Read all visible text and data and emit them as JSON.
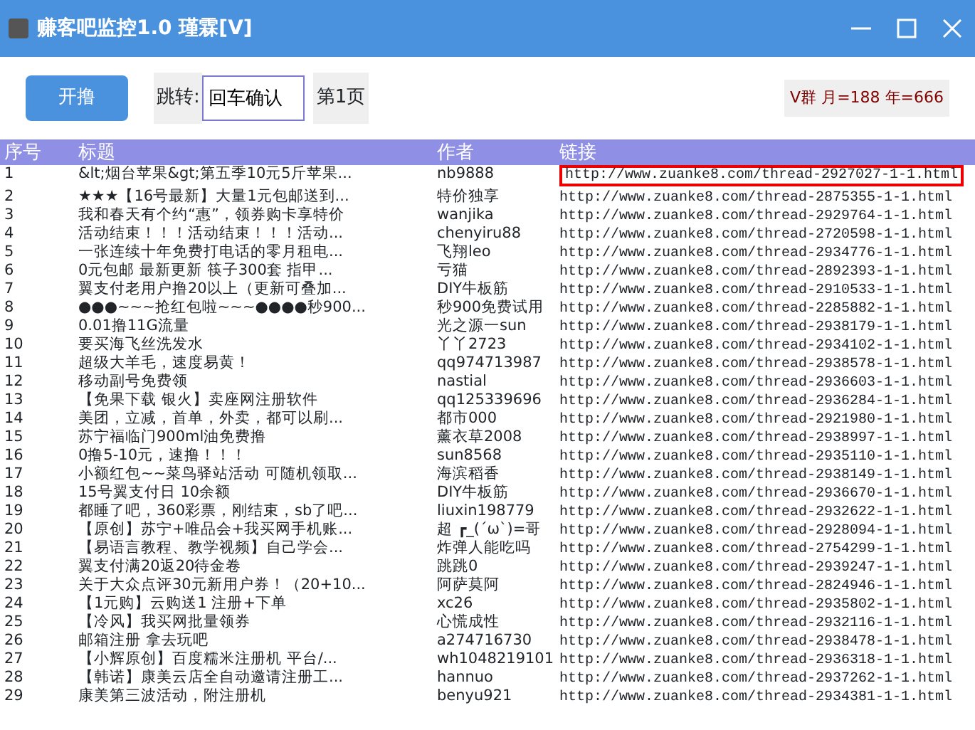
{
  "window": {
    "title": "赚客吧监控1.0 瑾霖[V]"
  },
  "toolbar": {
    "start_button": "开撸",
    "jump_label": "跳转:",
    "jump_field": {
      "value": "回车确认"
    },
    "page_label": "第1页",
    "notice": "V群 月=188 年=666"
  },
  "table": {
    "columns": [
      "序号",
      "标题",
      "作者",
      "链接"
    ],
    "rows": [
      {
        "cells": [
          "1",
          "&lt;烟台苹果&gt;第五季10元5斤苹果...",
          "nb9888",
          "http://www.zuanke8.com/thread-2927027-1-1.html"
        ],
        "highlighted": true
      },
      {
        "cells": [
          "2",
          "★★★【16号最新】大量1元包邮送到...",
          "特价独享",
          "http://www.zuanke8.com/thread-2875355-1-1.html"
        ],
        "highlighted": false
      },
      {
        "cells": [
          "3",
          "我和春天有个约“惠”，领券购卡享特价",
          "wanjika",
          "http://www.zuanke8.com/thread-2929764-1-1.html"
        ],
        "highlighted": false
      },
      {
        "cells": [
          "4",
          "活动结束！！！活动结束！！！活动...",
          "chenyiru88",
          "http://www.zuanke8.com/thread-2720598-1-1.html"
        ],
        "highlighted": false
      },
      {
        "cells": [
          "5",
          "一张连续十年免费打电话的零月租电...",
          "飞翔leo",
          "http://www.zuanke8.com/thread-2934776-1-1.html"
        ],
        "highlighted": false
      },
      {
        "cells": [
          "6",
          "0元包邮  最新更新 筷子300套 指甲...",
          "亏猫",
          "http://www.zuanke8.com/thread-2892393-1-1.html"
        ],
        "highlighted": false
      },
      {
        "cells": [
          "7",
          "翼支付老用户撸20以上（更新可叠加...",
          "DIY牛板筋",
          "http://www.zuanke8.com/thread-2910533-1-1.html"
        ],
        "highlighted": false
      },
      {
        "cells": [
          "8",
          "●●●~~~抢红包啦~~~●●●●秒900...",
          "秒900免费试用",
          "http://www.zuanke8.com/thread-2285882-1-1.html"
        ],
        "highlighted": false
      },
      {
        "cells": [
          "9",
          "0.01撸11G流量",
          "光之源一sun",
          "http://www.zuanke8.com/thread-2938179-1-1.html"
        ],
        "highlighted": false
      },
      {
        "cells": [
          "10",
          "要买海飞丝洗发水",
          "丫丫2723",
          "http://www.zuanke8.com/thread-2934102-1-1.html"
        ],
        "highlighted": false
      },
      {
        "cells": [
          "11",
          "超级大羊毛，速度易黄！",
          "qq974713987",
          "http://www.zuanke8.com/thread-2938578-1-1.html"
        ],
        "highlighted": false
      },
      {
        "cells": [
          "12",
          "移动副号免费领",
          "nastial",
          "http://www.zuanke8.com/thread-2936603-1-1.html"
        ],
        "highlighted": false
      },
      {
        "cells": [
          "13",
          "【免果下载 银火】卖座网注册软件",
          "qq125339696",
          "http://www.zuanke8.com/thread-2936284-1-1.html"
        ],
        "highlighted": false
      },
      {
        "cells": [
          "14",
          "美团，立减，首单，外卖，都可以刷...",
          "都市000",
          "http://www.zuanke8.com/thread-2921980-1-1.html"
        ],
        "highlighted": false
      },
      {
        "cells": [
          "15",
          "苏宁福临门900ml油免费撸",
          "薰衣草2008",
          "http://www.zuanke8.com/thread-2938997-1-1.html"
        ],
        "highlighted": false
      },
      {
        "cells": [
          "16",
          "0撸5-10元，速撸！！！",
          "sun8568",
          "http://www.zuanke8.com/thread-2935110-1-1.html"
        ],
        "highlighted": false
      },
      {
        "cells": [
          "17",
          "小额红包~~菜鸟驿站活动 可随机领取...",
          "海滨稻香",
          "http://www.zuanke8.com/thread-2938149-1-1.html"
        ],
        "highlighted": false
      },
      {
        "cells": [
          "18",
          "15号翼支付日 10余额",
          "DIY牛板筋",
          "http://www.zuanke8.com/thread-2936670-1-1.html"
        ],
        "highlighted": false
      },
      {
        "cells": [
          "19",
          "都睡了吧，360彩票，刚结束，sb了吧...",
          "liuxin198779",
          "http://www.zuanke8.com/thread-2932622-1-1.html"
        ],
        "highlighted": false
      },
      {
        "cells": [
          "20",
          "【原创】苏宁+唯品会+我买网手机账...",
          "超 ┏_(ˊωˋ)=哥",
          "http://www.zuanke8.com/thread-2928094-1-1.html"
        ],
        "highlighted": false
      },
      {
        "cells": [
          "21",
          "【易语言教程、教学视频】自己学会...",
          "炸弹人能吃吗",
          "http://www.zuanke8.com/thread-2754299-1-1.html"
        ],
        "highlighted": false
      },
      {
        "cells": [
          "22",
          "翼支付满20返20待金卷",
          "跳跳0",
          "http://www.zuanke8.com/thread-2939247-1-1.html"
        ],
        "highlighted": false
      },
      {
        "cells": [
          "23",
          "关于大众点评30元新用户券！（20+10...",
          "阿萨莫阿",
          "http://www.zuanke8.com/thread-2824946-1-1.html"
        ],
        "highlighted": false
      },
      {
        "cells": [
          "24",
          "【1元购】云购送1  注册+下单",
          "xc26",
          "http://www.zuanke8.com/thread-2935802-1-1.html"
        ],
        "highlighted": false
      },
      {
        "cells": [
          "25",
          "【冷风】我买网批量领券",
          "心慌成性",
          "http://www.zuanke8.com/thread-2932116-1-1.html"
        ],
        "highlighted": false
      },
      {
        "cells": [
          "26",
          "邮箱注册 拿去玩吧",
          "a274716730",
          "http://www.zuanke8.com/thread-2938478-1-1.html"
        ],
        "highlighted": false
      },
      {
        "cells": [
          "27",
          "【小辉原创】百度糯米注册机 平台/...",
          "wh1048219101",
          "http://www.zuanke8.com/thread-2936318-1-1.html"
        ],
        "highlighted": false
      },
      {
        "cells": [
          "28",
          "【韩诺】康美云店全自动邀请注册工...",
          "hannuo",
          "http://www.zuanke8.com/thread-2937262-1-1.html"
        ],
        "highlighted": false
      },
      {
        "cells": [
          "29",
          "康美第三波活动，附注册机",
          "benyu921",
          "http://www.zuanke8.com/thread-2934381-1-1.html"
        ],
        "highlighted": false
      }
    ]
  }
}
